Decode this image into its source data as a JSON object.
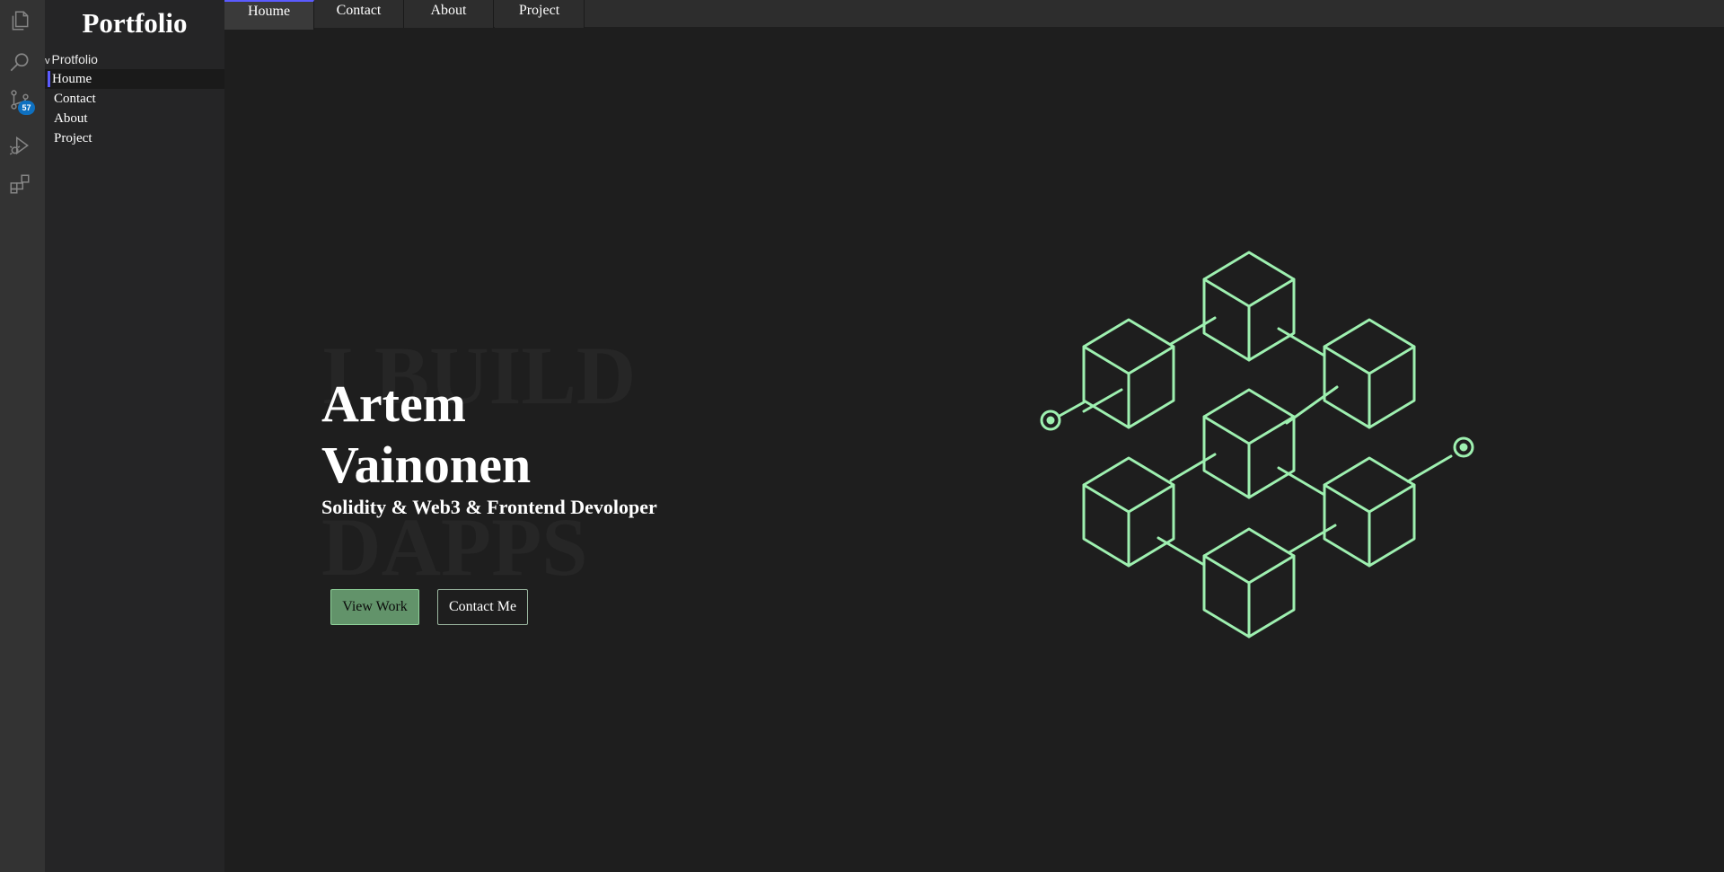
{
  "activity_bar": {
    "icons": [
      "files-icon",
      "search-icon",
      "source-control-icon",
      "run-debug-icon",
      "extensions-icon"
    ],
    "source_control_badge": "57"
  },
  "sidebar": {
    "title": "Portfolio",
    "root_label": "Protfolio",
    "items": [
      {
        "label": "Houme"
      },
      {
        "label": "Contact"
      },
      {
        "label": "About"
      },
      {
        "label": "Project"
      }
    ]
  },
  "tabs": [
    {
      "label": "Houme"
    },
    {
      "label": "Contact"
    },
    {
      "label": "About"
    },
    {
      "label": "Project"
    }
  ],
  "hero": {
    "bg_text_1": "I BUILD",
    "bg_text_2": "DAPPS",
    "name_line1": "Artem",
    "name_line2": "Vainonen",
    "subtitle": "Solidity & Web3 & Frontend Devoloper",
    "primary_button": "View Work",
    "secondary_button": "Contact Me"
  },
  "colors": {
    "accent": "#5b5bff",
    "illustration": "#9ef0b0",
    "button_primary": "#62936a",
    "background": "#1e1e1e"
  }
}
